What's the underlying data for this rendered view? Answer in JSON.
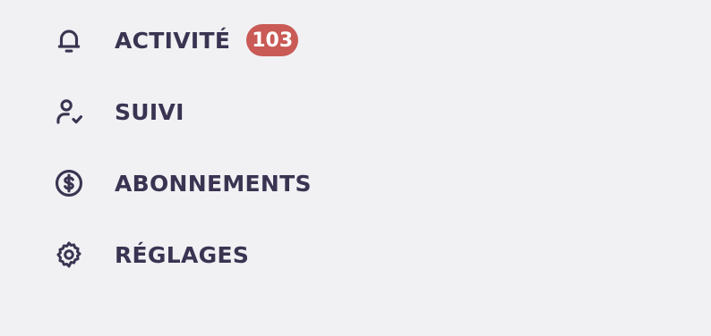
{
  "nav": {
    "items": [
      {
        "label": "ACTIVITÉ",
        "icon": "bell-icon",
        "badge": "103"
      },
      {
        "label": "SUIVI",
        "icon": "user-check-icon"
      },
      {
        "label": "ABONNEMENTS",
        "icon": "dollar-circle-icon"
      },
      {
        "label": "RÉGLAGES",
        "icon": "gear-icon"
      }
    ]
  },
  "colors": {
    "background": "#f1f0f3",
    "text": "#3a3452",
    "badge": "#c95a55"
  }
}
